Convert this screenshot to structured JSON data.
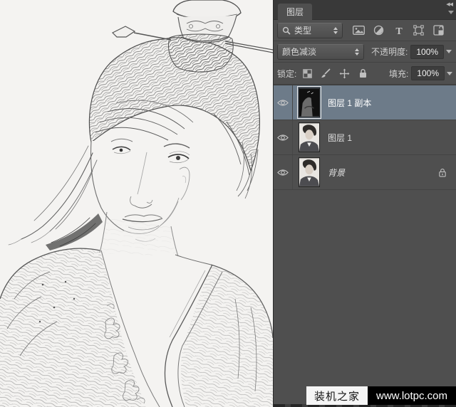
{
  "panel": {
    "tab_label": "图层",
    "filter_bar": {
      "search_type_label": "类型",
      "filter_icons": [
        "magnifier-icon",
        "pixel-layer-filter-icon",
        "adjustment-layer-filter-icon",
        "type-layer-filter-icon",
        "shape-layer-filter-icon",
        "smart-object-filter-icon"
      ]
    },
    "blend_bar": {
      "blend_mode": "颜色减淡",
      "opacity_label": "不透明度:",
      "opacity_value": "100%"
    },
    "lock_bar": {
      "lock_label": "锁定:",
      "lock_icons": [
        "lock-transparency-icon",
        "lock-paint-icon",
        "lock-position-icon",
        "lock-all-icon"
      ],
      "fill_label": "填充:",
      "fill_value": "100%"
    },
    "layers": [
      {
        "name": "图层 1 副本",
        "selected": true,
        "visible": true,
        "locked": false
      },
      {
        "name": "图层 1",
        "selected": false,
        "visible": true,
        "locked": false
      },
      {
        "name": "背景",
        "selected": false,
        "visible": true,
        "locked": true
      }
    ]
  },
  "watermark": {
    "brand": "装机之家",
    "url": "www.lotpc.com"
  },
  "canvas": {
    "description": "Pencil sketch portrait of a young man with a traditional Chinese topknot, ornate crown and horizontal hairpin"
  },
  "colors": {
    "panel_bg": "#4f4f4f",
    "panel_header_bg": "#393939",
    "selected_layer_bg": "#6d7b89",
    "watermark_white": "#f5f5f5",
    "watermark_black": "#000000"
  }
}
